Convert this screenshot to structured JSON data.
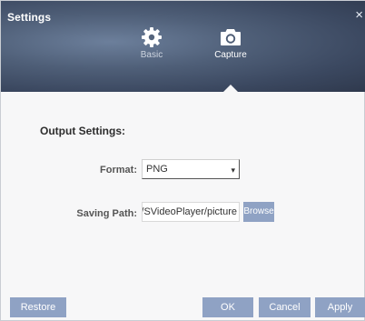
{
  "window": {
    "title": "Settings",
    "close_glyph": "×"
  },
  "tabs": [
    {
      "label": "Basic",
      "icon": "gear-icon",
      "selected": false
    },
    {
      "label": "Capture",
      "icon": "camera-icon",
      "selected": true
    }
  ],
  "section": {
    "title": "Output Settings:"
  },
  "format": {
    "label": "Format:",
    "value": "PNG",
    "arrow_glyph": "▾"
  },
  "saving_path": {
    "label": "Saving Path:",
    "value": "pr/SVideoPlayer/picture",
    "browse_label": "Browse"
  },
  "footer": {
    "restore_label": "Restore",
    "ok_label": "OK",
    "cancel_label": "Cancel",
    "apply_label": "Apply"
  },
  "colors": {
    "header_dark": "#2f394d",
    "header_light": "#6c7f9b",
    "button_bg": "#8fa2c4",
    "page_bg": "#f7f7f8"
  }
}
